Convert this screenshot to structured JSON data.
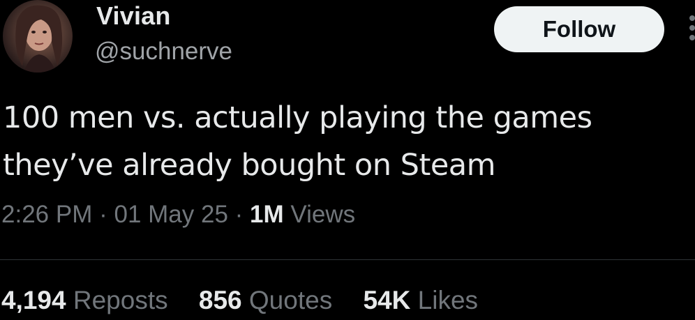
{
  "author": {
    "name": "Vivian",
    "handle": "@suchnerve"
  },
  "header": {
    "follow_label": "Follow",
    "more_icon": "more-vertical-icon"
  },
  "tweet": {
    "lines": [
      "100 men vs. actually playing the games",
      "they’ve already bought on Steam"
    ]
  },
  "meta": {
    "time": "2:26 PM",
    "separator": "·",
    "date": "01 May 25",
    "views_count": "1M",
    "views_label": "Views"
  },
  "stats": {
    "reposts_count": "4,194",
    "reposts_label": "Reposts",
    "quotes_count": "856",
    "quotes_label": "Quotes",
    "likes_count": "54K",
    "likes_label": "Likes"
  },
  "colors": {
    "background": "#000000",
    "primary_text": "#e7e9ea",
    "secondary_text": "#71767b",
    "follow_button_bg": "#eff3f4",
    "follow_button_text": "#0f1419",
    "divider": "#2f3336"
  }
}
